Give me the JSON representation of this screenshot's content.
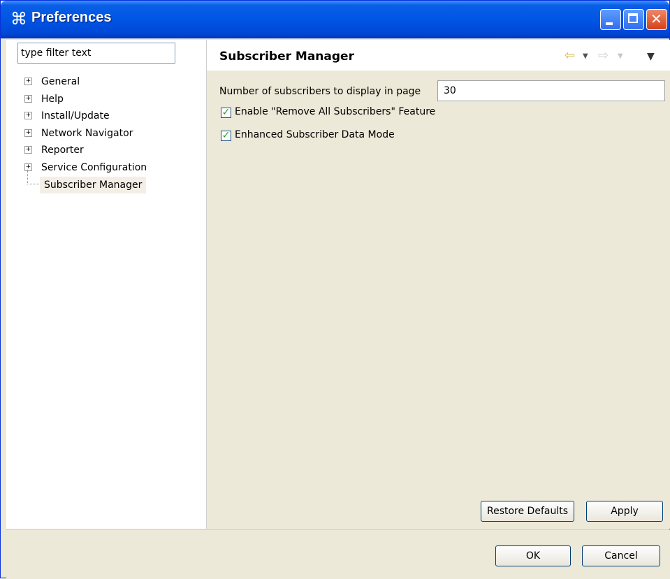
{
  "window": {
    "title": "Preferences",
    "title_icon": "preferences-icon"
  },
  "sidebar": {
    "filter_placeholder": "type filter text",
    "items": [
      {
        "label": "General",
        "expandable": true
      },
      {
        "label": "Help",
        "expandable": true
      },
      {
        "label": "Install/Update",
        "expandable": true
      },
      {
        "label": "Network Navigator",
        "expandable": true
      },
      {
        "label": "Reporter",
        "expandable": true
      },
      {
        "label": "Service Configuration",
        "expandable": true
      },
      {
        "label": "Subscriber Manager",
        "expandable": false,
        "selected": true
      }
    ]
  },
  "page": {
    "title": "Subscriber Manager",
    "subscribers_label": "Number of subscribers to display in page",
    "subscribers_value": "30",
    "remove_all_label": "Enable \"Remove All Subscribers\" Feature",
    "remove_all_checked": true,
    "enhanced_label": "Enhanced Subscriber Data Mode",
    "enhanced_checked": true
  },
  "buttons": {
    "restore_defaults": "Restore Defaults",
    "apply": "Apply",
    "ok": "OK",
    "cancel": "Cancel"
  },
  "colors": {
    "titlebar": "#0055e5",
    "accent_check": "#21a121"
  }
}
